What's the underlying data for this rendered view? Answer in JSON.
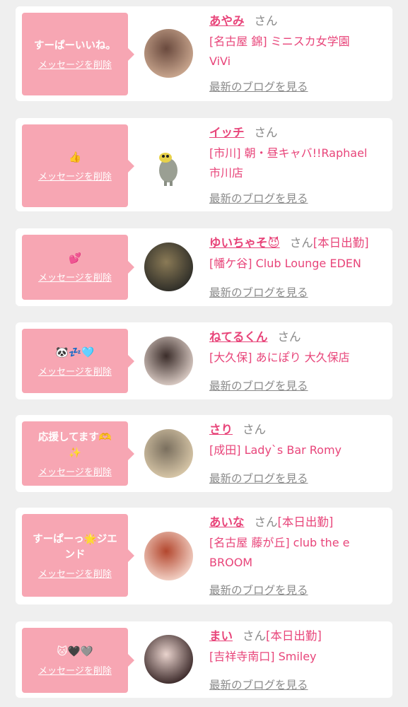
{
  "cards": [
    {
      "message": "すーぱーいいね。",
      "delete_label": "メッセージを削除",
      "name": "あやみ",
      "san": "さん",
      "badge": "",
      "shop": "[名古屋 錦] ミニスカ女学園\nViVi",
      "blog_label": "最新のブログを見る"
    },
    {
      "message": "👍",
      "delete_label": "メッセージを削除",
      "name": "イッチ",
      "san": "さん",
      "badge": "",
      "shop": "[市川] 朝・昼キャバ!!Raphael\n市川店",
      "blog_label": "最新のブログを見る"
    },
    {
      "message": "💕",
      "delete_label": "メッセージを削除",
      "name": "ゆいちゃそ😈",
      "san": "さん",
      "badge": "[本日出勤]",
      "shop": "[幡ケ谷] Club Lounge EDEN",
      "blog_label": "最新のブログを見る"
    },
    {
      "message": "🐼💤🩵",
      "delete_label": "メッセージを削除",
      "name": "ねてるくん",
      "san": "さん",
      "badge": "",
      "shop": "[大久保] あにぽり 大久保店",
      "blog_label": "最新のブログを見る"
    },
    {
      "message": "応援してます🫶\n✨",
      "delete_label": "メッセージを削除",
      "name": "さり",
      "san": "さん",
      "badge": "",
      "shop": "[成田] Lady`s Bar Romy",
      "blog_label": "最新のブログを見る"
    },
    {
      "message": "すーぱーっ🌟ジエ\nンド",
      "delete_label": "メッセージを削除",
      "name": "あいな",
      "san": "さん",
      "badge": "[本日出勤]",
      "shop": "[名古屋 藤が丘] club the e\nBROOM",
      "blog_label": "最新のブログを見る"
    },
    {
      "message": "🐱🖤🩶",
      "delete_label": "メッセージを削除",
      "name": "まい",
      "san": "さん",
      "badge": "[本日出勤]",
      "shop": "[吉祥寺南口] Smiley",
      "blog_label": "最新のブログを見る"
    }
  ],
  "colors": {
    "accent": "#e8457a",
    "bubble": "#f7a6b3",
    "background": "#efefef"
  }
}
